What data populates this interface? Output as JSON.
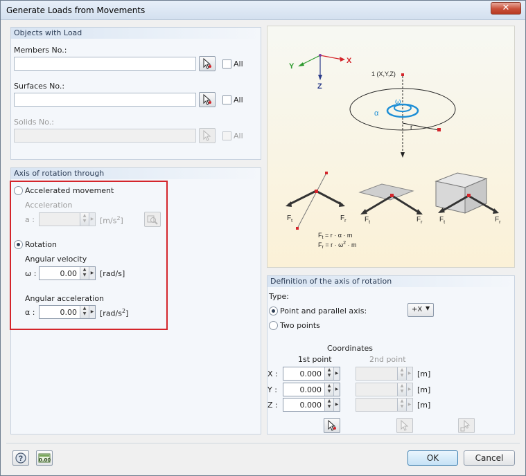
{
  "window": {
    "title": "Generate Loads from Movements",
    "close_glyph": "✕"
  },
  "objects": {
    "header": "Objects with Load",
    "members_label": "Members No.:",
    "surfaces_label": "Surfaces No.:",
    "solids_label": "Solids No.:",
    "all_label": "All"
  },
  "axis_through": {
    "header": "Axis of rotation through",
    "accelerated_label": "Accelerated movement",
    "acceleration_label": "Acceleration",
    "a_label": "a :",
    "a_unit": "[m/s",
    "a_unit_sup": "2",
    "a_unit_close": "]",
    "rotation_label": "Rotation",
    "angular_velocity_label": "Angular velocity",
    "omega_label": "ω :",
    "omega_value": "0.00",
    "omega_unit": "[rad/s]",
    "angular_accel_label": "Angular acceleration",
    "alpha_label": "α :",
    "alpha_value": "0.00",
    "alpha_unit": "[rad/s",
    "alpha_unit_sup": "2",
    "alpha_unit_close": "]",
    "selected": "rotation"
  },
  "figure": {
    "axis_x": "X",
    "axis_y": "Y",
    "axis_z": "Z",
    "point_label": "1 (X,Y,Z)",
    "omega": "ω",
    "alpha": "α",
    "r": "r",
    "ft": "F",
    "ft_sub": "t",
    "fr": "F",
    "fr_sub": "r",
    "formula1_lhs": "F",
    "formula1_sub": "t",
    "formula1_rhs": " = r · α · m",
    "formula2_lhs": "F",
    "formula2_sub": "r",
    "formula2_rhs": " = r · ω",
    "formula2_sup": "2",
    "formula2_tail": " · m"
  },
  "definition": {
    "header": "Definition of the axis of rotation",
    "type_label": "Type:",
    "point_parallel_label": "Point and parallel axis:",
    "two_points_label": "Two points",
    "direction_value": "+X",
    "selected": "point_parallel",
    "coordinates_label": "Coordinates",
    "first_point_label": "1st point",
    "second_point_label": "2nd point",
    "rows": [
      {
        "axis": "X :",
        "value": "0.000",
        "unit": "[m]"
      },
      {
        "axis": "Y :",
        "value": "0.000",
        "unit": "[m]"
      },
      {
        "axis": "Z :",
        "value": "0.000",
        "unit": "[m]"
      }
    ]
  },
  "footer": {
    "ok_label": "OK",
    "cancel_label": "Cancel",
    "units_icon_text": "0.00"
  },
  "colors": {
    "highlight_frame": "#d4252b",
    "accent_blue": "#1e8fd6",
    "axis_red": "#d4252b",
    "axis_green": "#2e9a2e"
  }
}
